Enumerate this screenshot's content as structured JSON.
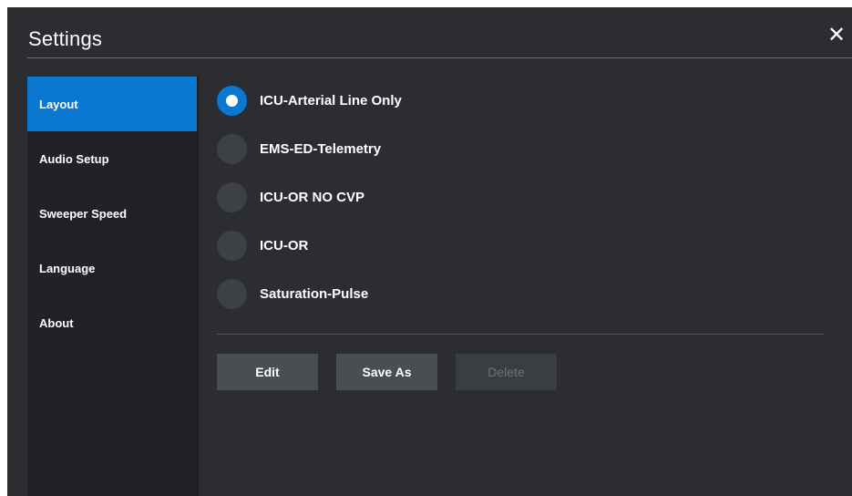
{
  "dialog": {
    "title": "Settings",
    "close_icon": "close-icon",
    "close_glyph": "✕"
  },
  "sidebar": {
    "items": [
      {
        "label": "Layout",
        "active": true
      },
      {
        "label": "Audio Setup",
        "active": false
      },
      {
        "label": "Sweeper Speed",
        "active": false
      },
      {
        "label": "Language",
        "active": false
      },
      {
        "label": "About",
        "active": false
      }
    ]
  },
  "layout_options": {
    "selected": "ICU-Arterial Line Only",
    "items": [
      {
        "label": "ICU-Arterial Line Only",
        "selected": true
      },
      {
        "label": "EMS-ED-Telemetry",
        "selected": false
      },
      {
        "label": "ICU-OR NO CVP",
        "selected": false
      },
      {
        "label": "ICU-OR",
        "selected": false
      },
      {
        "label": "Saturation-Pulse",
        "selected": false
      }
    ]
  },
  "actions": {
    "edit_label": "Edit",
    "save_as_label": "Save As",
    "delete_label": "Delete",
    "delete_enabled": false
  },
  "colors": {
    "accent": "#0a78d1",
    "background": "#2b2d31",
    "sidebar": "#202226",
    "button": "#4a4d52"
  }
}
